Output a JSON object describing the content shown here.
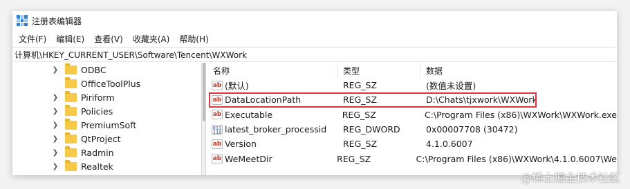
{
  "window": {
    "title": "注册表编辑器"
  },
  "menu": [
    "文件(F)",
    "编辑(E)",
    "查看(V)",
    "收藏夹(A)",
    "帮助(H)"
  ],
  "address": "计算机\\HKEY_CURRENT_USER\\Software\\Tencent\\WXWork",
  "tree": [
    {
      "label": "ODBC",
      "expandable": true
    },
    {
      "label": "OfficeToolPlus",
      "expandable": false
    },
    {
      "label": "Piriform",
      "expandable": true
    },
    {
      "label": "Policies",
      "expandable": true
    },
    {
      "label": "PremiumSoft",
      "expandable": true
    },
    {
      "label": "QtProject",
      "expandable": true
    },
    {
      "label": "Radmin",
      "expandable": true
    },
    {
      "label": "Realtek",
      "expandable": true
    }
  ],
  "list": {
    "headers": {
      "name": "名称",
      "type": "类型",
      "data": "数据"
    },
    "rows": [
      {
        "icon": "string",
        "name": "(默认)",
        "type": "REG_SZ",
        "data": "(数值未设置)"
      },
      {
        "icon": "string",
        "name": "DataLocationPath",
        "type": "REG_SZ",
        "data": "D:\\Chats\\tjxwork\\WXWork",
        "highlighted": true
      },
      {
        "icon": "string",
        "name": "Executable",
        "type": "REG_SZ",
        "data": "C:\\Program Files (x86)\\WXWork\\WXWork.exe"
      },
      {
        "icon": "binary",
        "name": "latest_broker_processid",
        "type": "REG_DWORD",
        "data": "0x00007708 (30472)"
      },
      {
        "icon": "string",
        "name": "Version",
        "type": "REG_SZ",
        "data": "4.1.0.6007"
      },
      {
        "icon": "string",
        "name": "WeMeetDir",
        "type": "REG_SZ",
        "data": "C:\\Program Files (x86)\\WXWork\\4.1.0.6007\\We"
      }
    ]
  },
  "watermark": "@稀土掘金技术社区",
  "colors": {
    "highlight": "#d9363e",
    "folder": "#f7c948"
  }
}
